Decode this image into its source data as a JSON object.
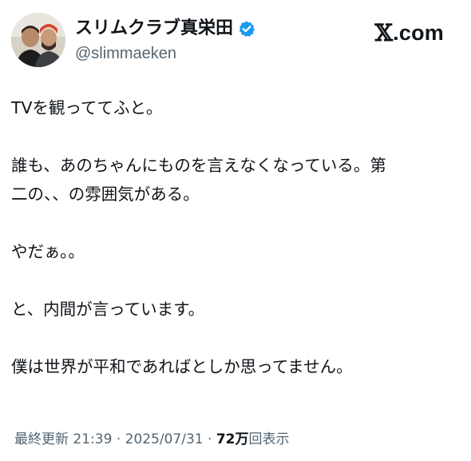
{
  "author": {
    "display_name": "スリムクラブ真栄田",
    "handle": "@slimmaeken",
    "verified": true
  },
  "brand": {
    "glyph": "𝕏",
    "suffix": ".com"
  },
  "tweet": {
    "lines": [
      "TVを観っててふと。",
      "",
      "誰も、あのちゃんにものを言えなくなっている。第",
      "二の、、の雰囲気がある。",
      "",
      "やだぁ。。",
      "",
      "と、内間が言っています。",
      "",
      "僕は世界が平和であればとしか思ってません。"
    ]
  },
  "meta": {
    "last_updated_label": "最終更新",
    "time": "21:39",
    "separator": "·",
    "date": "2025/07/31",
    "views_count": "72万",
    "views_label": "回表示"
  },
  "colors": {
    "text_primary": "#0f1419",
    "text_secondary": "#536471",
    "verified_blue": "#1d9bf0"
  }
}
